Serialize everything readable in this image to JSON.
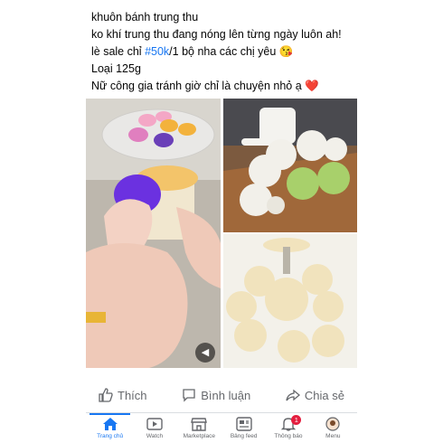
{
  "post": {
    "line1": "khuôn bánh trung thu",
    "line2": "ko khí trung thu đang nóng lên từng ngày luôn ah!",
    "line3_prefix": "lè sale chỉ ",
    "line3_hashtag": "#50k",
    "line3_suffix": "/1 bộ nha các chị yêu 😘",
    "line4": "Loại 125g",
    "line5": "Nữ công gia tránh giờ chỉ là chuyện nhỏ ạ ❤️"
  },
  "actions": {
    "like": "Thích",
    "comment": "Bình luận",
    "share": "Chia sẻ"
  },
  "tabs": [
    {
      "label": "Trang chủ",
      "icon": "home-icon"
    },
    {
      "label": "Watch",
      "icon": "watch-icon"
    },
    {
      "label": "Marketplace",
      "icon": "marketplace-icon"
    },
    {
      "label": "Bảng feed",
      "icon": "feed-icon"
    },
    {
      "label": "Thông báo",
      "icon": "bell-icon",
      "badge": "1"
    },
    {
      "label": "Menu",
      "icon": "avatar-icon"
    }
  ],
  "colors": {
    "accent": "#1877f2",
    "badge": "#e41e3f",
    "muted_text": "#65676b"
  }
}
